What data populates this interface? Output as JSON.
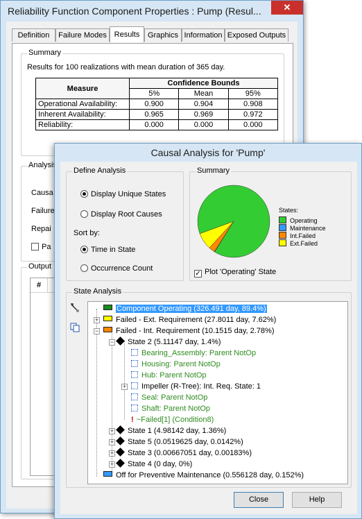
{
  "props_window": {
    "title": "Reliability Function Component Properties : Pump (Resul...",
    "close_glyph": "✕",
    "tabs": [
      "Definition",
      "Failure Modes",
      "Results",
      "Graphics",
      "Information",
      "Exposed Outputs"
    ],
    "active_tab": "Results",
    "summary": {
      "label": "Summary",
      "text": "Results for 100 realizations with mean duration of 365 day.",
      "table": {
        "header_measure": "Measure",
        "header_bounds": "Confidence Bounds",
        "sub_headers": [
          "5%",
          "Mean",
          "95%"
        ],
        "rows": [
          {
            "name": "Operational Availability:",
            "values": [
              "0.900",
              "0.904",
              "0.908"
            ]
          },
          {
            "name": "Inherent Availability:",
            "values": [
              "0.965",
              "0.969",
              "0.972"
            ]
          },
          {
            "name": "Reliability:",
            "values": [
              "0.000",
              "0.000",
              "0.000"
            ]
          }
        ]
      }
    },
    "analysis": {
      "label": "Analysis",
      "partial_labels": [
        "Causa",
        "Failure",
        "Repai",
        "Pa"
      ]
    },
    "output": {
      "label": "Output I",
      "col_hash": "#"
    }
  },
  "causal_window": {
    "title": "Causal Analysis for 'Pump'",
    "define": {
      "label": "Define Analysis",
      "opt_unique": "Display Unique States",
      "opt_root": "Display Root Causes",
      "sort_label": "Sort by:",
      "sort_time": "Time in State",
      "sort_count": "Occurrence Count"
    },
    "summary": {
      "label": "Summary",
      "states_label": "States:",
      "plot_operating_label": "Plot 'Operating' State",
      "legend": [
        {
          "name": "Operating",
          "color": "#33cc33"
        },
        {
          "name": "Maintenance",
          "color": "#3399ff"
        },
        {
          "name": "Int.Failed",
          "color": "#ff8800"
        },
        {
          "name": "Ext.Failed",
          "color": "#ffff00"
        }
      ]
    },
    "pie_data": {
      "type": "pie",
      "slices": [
        {
          "label": "Operating",
          "value": 89.4,
          "color": "#33cc33"
        },
        {
          "label": "Maintenance",
          "value": 0.152,
          "color": "#3399ff"
        },
        {
          "label": "Int.Failed",
          "value": 2.78,
          "color": "#ff8800"
        },
        {
          "label": "Ext.Failed",
          "value": 7.62,
          "color": "#ffff00"
        }
      ]
    },
    "state_analysis": {
      "label": "State Analysis",
      "nodes": [
        "Component Operating (326.491 day, 89.4%)",
        "Failed - Ext. Requirement (27.8011 day, 7.62%)",
        "Failed - Int. Requirement (10.1515 day, 2.78%)",
        "State 2 (5.11147 day, 1.4%)",
        "Bearing_Assembly: Parent NotOp",
        "Housing: Parent NotOp",
        "Hub: Parent NotOp",
        "Impeller (R-Tree): Int. Req. State: 1",
        "Seal: Parent NotOp",
        "Shaft: Parent NotOp",
        "~Failed[1]  (Condition8)",
        "State 1 (4.98142 day, 1.36%)",
        "State 5 (0.0519625 day, 0.0142%)",
        "State 3 (0.00667051 day, 0.00183%)",
        "State 4 (0 day, 0%)",
        "Off for Preventive Maintenance (0.556128 day, 0.152%)"
      ]
    },
    "buttons": {
      "close": "Close",
      "help": "Help"
    }
  }
}
